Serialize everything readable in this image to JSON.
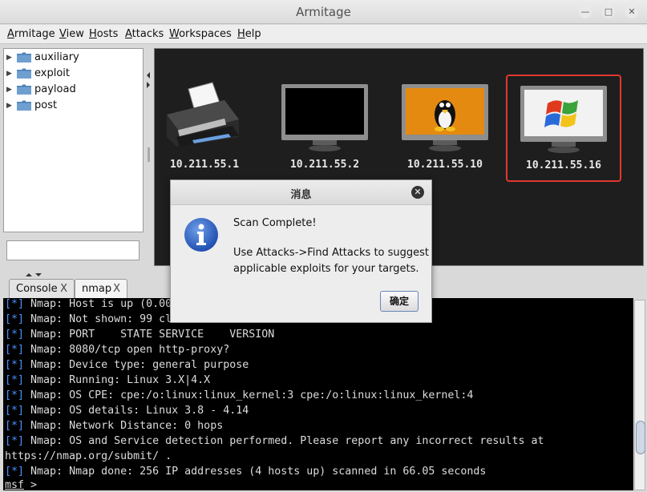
{
  "window": {
    "title": "Armitage"
  },
  "menubar": {
    "items": [
      {
        "label": "Armitage",
        "mnemonic": "A"
      },
      {
        "label": "View",
        "mnemonic": "V"
      },
      {
        "label": "Hosts",
        "mnemonic": "H"
      },
      {
        "label": "Attacks",
        "mnemonic": "A"
      },
      {
        "label": "Workspaces",
        "mnemonic": "W"
      },
      {
        "label": "Help",
        "mnemonic": "H"
      }
    ]
  },
  "module_tree": {
    "items": [
      {
        "label": "auxiliary",
        "icon": "folder-icon"
      },
      {
        "label": "exploit",
        "icon": "folder-icon"
      },
      {
        "label": "payload",
        "icon": "folder-icon"
      },
      {
        "label": "post",
        "icon": "folder-icon"
      }
    ],
    "search_value": ""
  },
  "targets": [
    {
      "ip": "10.211.55.1",
      "icon": "printer-icon",
      "selected": false
    },
    {
      "ip": "10.211.55.2",
      "icon": "monitor-icon",
      "selected": false
    },
    {
      "ip": "10.211.55.10",
      "icon": "linux-monitor-icon",
      "selected": false
    },
    {
      "ip": "10.211.55.16",
      "icon": "windows-monitor-icon",
      "selected": true
    }
  ],
  "tabs": [
    {
      "label": "Console",
      "close": "X"
    },
    {
      "label": "nmap",
      "close": "X",
      "active": true
    }
  ],
  "console": {
    "lines": [
      {
        "tag": "[*]",
        "text": " Nmap: Host is up (0.0000"
      },
      {
        "tag": "[*]",
        "text": " Nmap: Not shown: 99 clos"
      },
      {
        "tag": "[*]",
        "text": " Nmap: PORT    STATE SERVICE    VERSION"
      },
      {
        "tag": "[*]",
        "text": " Nmap: 8080/tcp open http-proxy?"
      },
      {
        "tag": "[*]",
        "text": " Nmap: Device type: general purpose"
      },
      {
        "tag": "[*]",
        "text": " Nmap: Running: Linux 3.X|4.X"
      },
      {
        "tag": "[*]",
        "text": " Nmap: OS CPE: cpe:/o:linux:linux_kernel:3 cpe:/o:linux:linux_kernel:4"
      },
      {
        "tag": "[*]",
        "text": " Nmap: OS details: Linux 3.8 - 4.14"
      },
      {
        "tag": "[*]",
        "text": " Nmap: Network Distance: 0 hops"
      },
      {
        "tag": "[*]",
        "text": " Nmap: OS and Service detection performed. Please report any incorrect results at"
      },
      {
        "tag": "",
        "text": "https://nmap.org/submit/ ."
      },
      {
        "tag": "[*]",
        "text": " Nmap: Nmap done: 256 IP addresses (4 hosts up) scanned in 66.05 seconds"
      }
    ],
    "prompt": "msf",
    "prompt_suffix": " >"
  },
  "dialog": {
    "title": "消息",
    "close": "✕",
    "heading": "Scan Complete!",
    "body_line1": "Use Attacks->Find Attacks to suggest",
    "body_line2": "applicable exploits for your targets.",
    "ok_label": "确定"
  },
  "colors": {
    "selection": "#e0382e",
    "console_tag": "#4a90ff",
    "console_bg": "#000000"
  }
}
